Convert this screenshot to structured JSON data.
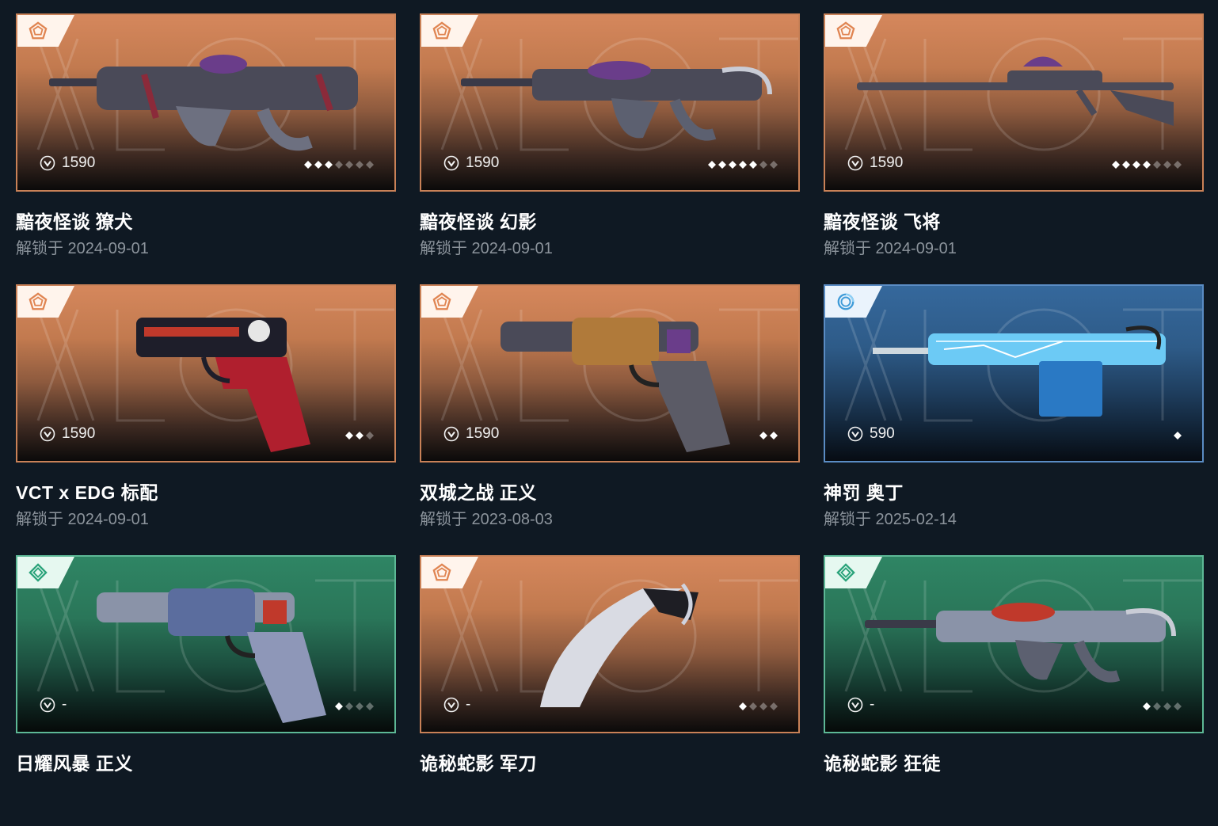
{
  "unlock_prefix": "解锁于",
  "colors": {
    "background": "#0f1923",
    "tier_orange": "#c98157",
    "tier_blue": "#5a8cc4",
    "tier_green": "#5db896"
  },
  "items": [
    {
      "name": "黯夜怪谈 獠犬",
      "unlock_label": "解锁于 2024-09-01",
      "price": "1590",
      "tier": "orange",
      "tier_icon": "deluxe-pentagon-icon",
      "levels_filled": 3,
      "levels_total": 7,
      "weapon_icon": "smg-icon"
    },
    {
      "name": "黯夜怪谈 幻影",
      "unlock_label": "解锁于 2024-09-01",
      "price": "1590",
      "tier": "orange",
      "tier_icon": "deluxe-pentagon-icon",
      "levels_filled": 5,
      "levels_total": 7,
      "weapon_icon": "rifle-icon"
    },
    {
      "name": "黯夜怪谈 飞将",
      "unlock_label": "解锁于 2024-09-01",
      "price": "1590",
      "tier": "orange",
      "tier_icon": "deluxe-pentagon-icon",
      "levels_filled": 4,
      "levels_total": 7,
      "weapon_icon": "sniper-rifle-icon"
    },
    {
      "name": "VCT x EDG 标配",
      "unlock_label": "解锁于 2024-09-01",
      "price": "1590",
      "tier": "orange",
      "tier_icon": "deluxe-pentagon-icon",
      "levels_filled": 2,
      "levels_total": 3,
      "weapon_icon": "pistol-icon"
    },
    {
      "name": "双城之战 正义",
      "unlock_label": "解锁于 2023-08-03",
      "price": "1590",
      "tier": "orange",
      "tier_icon": "deluxe-pentagon-icon",
      "levels_filled": 2,
      "levels_total": 2,
      "weapon_icon": "revolver-icon"
    },
    {
      "name": "神罚 奥丁",
      "unlock_label": "解锁于 2025-02-14",
      "price": "590",
      "tier": "blue",
      "tier_icon": "select-swirl-icon",
      "levels_filled": 1,
      "levels_total": 1,
      "weapon_icon": "machine-gun-icon"
    },
    {
      "name": "日耀风暴 正义",
      "unlock_label": "",
      "price": "-",
      "tier": "green",
      "tier_icon": "premium-diamond-icon",
      "levels_filled": 1,
      "levels_total": 4,
      "weapon_icon": "revolver-icon"
    },
    {
      "name": "诡秘蛇影 军刀",
      "unlock_label": "",
      "price": "-",
      "tier": "orange",
      "tier_icon": "deluxe-pentagon-icon",
      "levels_filled": 1,
      "levels_total": 4,
      "weapon_icon": "knife-icon"
    },
    {
      "name": "诡秘蛇影 狂徒",
      "unlock_label": "",
      "price": "-",
      "tier": "green",
      "tier_icon": "premium-diamond-icon",
      "levels_filled": 1,
      "levels_total": 4,
      "weapon_icon": "rifle-icon"
    }
  ]
}
